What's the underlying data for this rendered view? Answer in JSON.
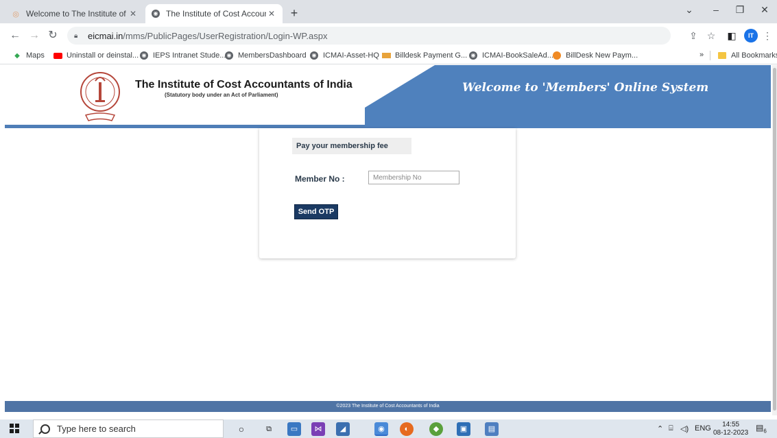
{
  "browser": {
    "tabs": [
      {
        "title": "Welcome to The Institute of Cos",
        "active": false
      },
      {
        "title": "The Institute of Cost Accountant",
        "active": true
      }
    ],
    "address": {
      "host": "eicmai.in",
      "path": "/mms/PublicPages/UserRegistration/Login-WP.aspx"
    },
    "profile_initials": "IT",
    "bookmarks": [
      {
        "label": "Maps",
        "icon": "maps-icon"
      },
      {
        "label": "Uninstall or deinstal...",
        "icon": "youtube-icon"
      },
      {
        "label": "IEPS Intranet Stude...",
        "icon": "globe-icon"
      },
      {
        "label": "MembersDashboard",
        "icon": "globe-icon"
      },
      {
        "label": "ICMAI-Asset-HQ",
        "icon": "globe-icon"
      },
      {
        "label": "Billdesk Payment G...",
        "icon": "card-icon"
      },
      {
        "label": "ICMAI-BookSaleAd...",
        "icon": "globe-icon"
      },
      {
        "label": "BillDesk New Paym...",
        "icon": "billdesk-icon"
      }
    ],
    "more_bookmarks": "»",
    "all_bookmarks": "All Bookmarks"
  },
  "header": {
    "institute_name": "The Institute of Cost Accountants of India",
    "institute_subtitle": "(Statutory body under an Act of Parliament)",
    "welcome": "Welcome to 'Members' Online System"
  },
  "form": {
    "title": "Pay your membership fee",
    "member_label": "Member No :",
    "member_placeholder": "Membership No",
    "member_value": "",
    "send_otp_label": "Send OTP"
  },
  "footer": {
    "text": "©2023 The Institute of Cost Accountants of India"
  },
  "taskbar": {
    "search_placeholder": "Type here to search",
    "language": "ENG",
    "time": "14:55",
    "date": "08-12-2023",
    "notification_count": "6"
  },
  "colors": {
    "header_blue": "#4f81bd",
    "button_navy": "#1b3a63",
    "footer_blue": "#4f74a5"
  }
}
